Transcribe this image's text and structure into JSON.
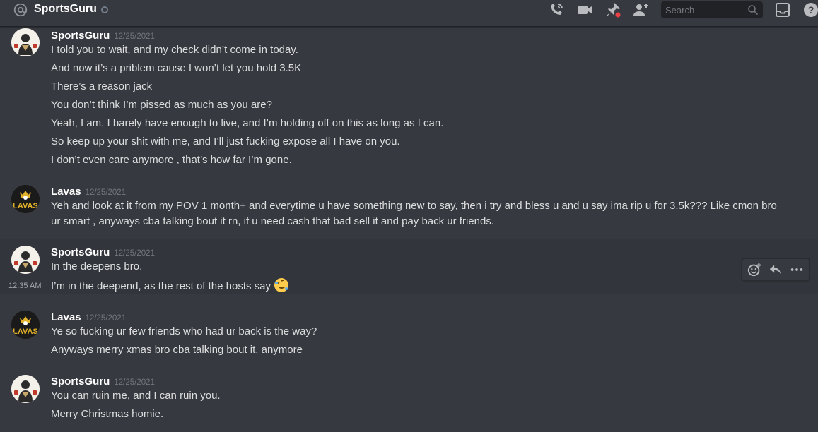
{
  "header": {
    "channel_name": "SportsGuru",
    "search_placeholder": "Search",
    "icons": [
      "at-icon",
      "phone-call-icon",
      "video-icon",
      "pin-icon",
      "add-friend-icon",
      "inbox-icon",
      "help-icon"
    ]
  },
  "messages": [
    {
      "author": "SportsGuru",
      "timestamp": "12/25/2021",
      "lines": [
        "I told you to wait, and my check didn’t come in today.",
        "And now it’s a priblem cause I won’t let you hold 3.5K",
        "There’s a reason jack",
        "You don’t think I’m pissed as much as you are?",
        "Yeah, I am. I barely have enough to live, and I’m holding off on this as long as I can.",
        "So keep up your shit with me, and I’ll just fucking expose all I have on you.",
        "I don’t even care anymore , that’s how far I’m gone."
      ]
    },
    {
      "author": "Lavas",
      "timestamp": "12/25/2021",
      "lines": [
        "Yeh and look at it from my POV 1 month+ and everytime u have something new to say,  then i try and bless u and u say ima rip u for 3.5k??? Like cmon bro ur smart , anyways cba talking bout it rn, if u need cash that bad sell it and pay back ur friends."
      ]
    },
    {
      "author": "SportsGuru",
      "timestamp": "12/25/2021",
      "lines": [
        "In the deepens bro.",
        "I’m in the deepend, as the rest of the hosts say"
      ],
      "hover_time": "12:35 AM"
    },
    {
      "author": "Lavas",
      "timestamp": "12/25/2021",
      "lines": [
        "Ye so fucking ur few friends who had ur back is the way?",
        "Anyways merry xmas bro cba talking bout it, anymore"
      ]
    },
    {
      "author": "SportsGuru",
      "timestamp": "12/25/2021",
      "lines": [
        "You can ruin me, and I can ruin you.",
        "Merry Christmas homie."
      ]
    }
  ],
  "avatars": {
    "sportsguru_bg": "#f4f0ea",
    "lavas_bg": "#1a1a1a",
    "lavas_text": "LAVAS",
    "lavas_text_color": "#e3b22b"
  },
  "colors": {
    "background": "#36393f",
    "header_text": "#ffffff",
    "message_text": "#dcddde",
    "muted": "#72767d",
    "notification_red": "#ed4245"
  }
}
